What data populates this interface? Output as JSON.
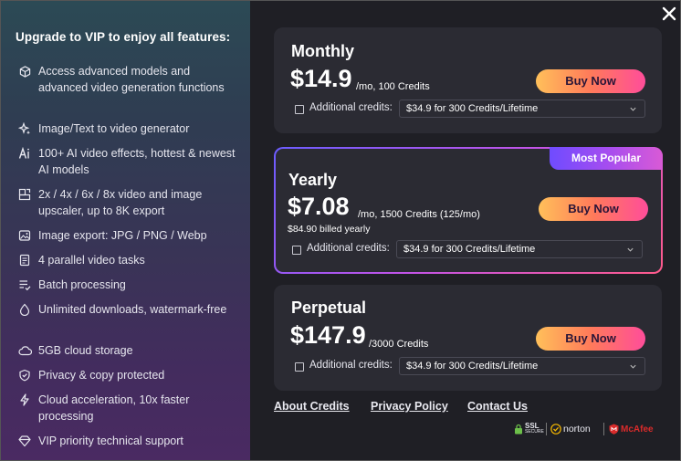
{
  "left": {
    "title": "Upgrade to VIP to enjoy all features:",
    "features": [
      {
        "icon": "cube-icon",
        "text": "Access advanced models and advanced video generation functions"
      },
      {
        "icon": "sparkle-icon",
        "text": "Image/Text to video generator"
      },
      {
        "icon": "ai-icon",
        "text": "100+ AI video effects, hottest & newest AI models"
      },
      {
        "icon": "upscale-icon",
        "text": "2x / 4x / 6x / 8x video and image upscaler, up to 8K export"
      },
      {
        "icon": "image-icon",
        "text": "Image export: JPG / PNG / Webp"
      },
      {
        "icon": "document-icon",
        "text": "4 parallel video tasks"
      },
      {
        "icon": "batch-icon",
        "text": "Batch processing"
      },
      {
        "icon": "drop-icon",
        "text": "Unlimited downloads, watermark-free"
      },
      {
        "icon": "cloud-icon",
        "text": "5GB cloud storage"
      },
      {
        "icon": "shield-icon",
        "text": "Privacy & copy protected"
      },
      {
        "icon": "lightning-icon",
        "text": "Cloud acceleration, 10x faster processing"
      },
      {
        "icon": "diamond-icon",
        "text": "VIP priority technical support"
      }
    ]
  },
  "plans": {
    "monthly": {
      "name": "Monthly",
      "price": "$14.9",
      "per": "/mo, 100 Credits",
      "buy_label": "Buy Now",
      "additional_label": "Additional credits:",
      "option": "$34.9 for 300 Credits/Lifetime"
    },
    "yearly": {
      "badge": "Most Popular",
      "name": "Yearly",
      "price": "$7.08",
      "per": "/mo, 1500 Credits (125/mo)",
      "billed": "$84.90 billed yearly",
      "buy_label": "Buy Now",
      "additional_label": "Additional credits:",
      "option": "$34.9 for 300 Credits/Lifetime"
    },
    "perpetual": {
      "name": "Perpetual",
      "price": "$147.9",
      "per": "/3000 Credits",
      "buy_label": "Buy Now",
      "additional_label": "Additional credits:",
      "option": "$34.9 for 300 Credits/Lifetime"
    }
  },
  "footer": {
    "links": [
      "About Credits",
      "Privacy Policy",
      "Contact Us"
    ],
    "trust": {
      "ssl": "SSL",
      "ssl_sub": "SECURE",
      "norton": "norton",
      "mcafee": "McAfee"
    }
  },
  "colors": {
    "accent_gradient_start": "#ffc05a",
    "accent_gradient_end": "#ff4d9a",
    "popular_badge": "#a44df0",
    "card_bg": "#2b2b33",
    "window_bg": "#1f1f25"
  }
}
